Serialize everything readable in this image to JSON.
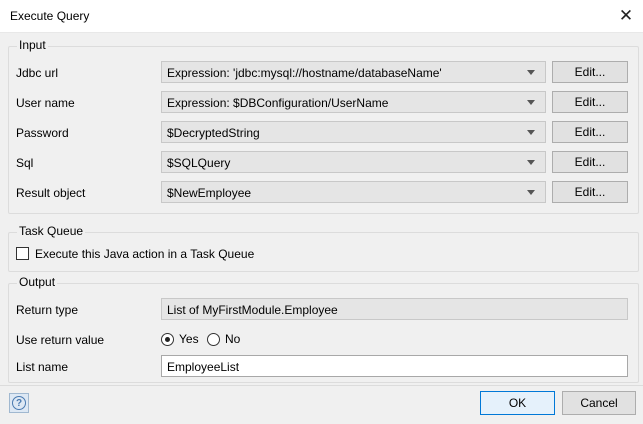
{
  "window": {
    "title": "Execute Query"
  },
  "input": {
    "label": "Input",
    "rows": [
      {
        "label": "Jdbc url",
        "value": "Expression: 'jdbc:mysql://hostname/databaseName'",
        "button": "Edit..."
      },
      {
        "label": "User name",
        "value": "Expression: $DBConfiguration/UserName",
        "button": "Edit..."
      },
      {
        "label": "Password",
        "value": "$DecryptedString",
        "button": "Edit..."
      },
      {
        "label": "Sql",
        "value": "$SQLQuery",
        "button": "Edit..."
      },
      {
        "label": "Result object",
        "value": "$NewEmployee",
        "button": "Edit..."
      }
    ]
  },
  "task_queue": {
    "label": "Task Queue",
    "checkbox_label": "Execute this Java action in a Task Queue",
    "checked": false
  },
  "output": {
    "label": "Output",
    "return_type_label": "Return type",
    "return_type_value": "List of MyFirstModule.Employee",
    "use_return_label": "Use return value",
    "yes_label": "Yes",
    "no_label": "No",
    "selected": "Yes",
    "list_name_label": "List name",
    "list_name_value": "EmployeeList"
  },
  "footer": {
    "help_icon": "question-circle-icon",
    "ok_label": "OK",
    "cancel_label": "Cancel",
    "accent_color": "#0078d7"
  }
}
